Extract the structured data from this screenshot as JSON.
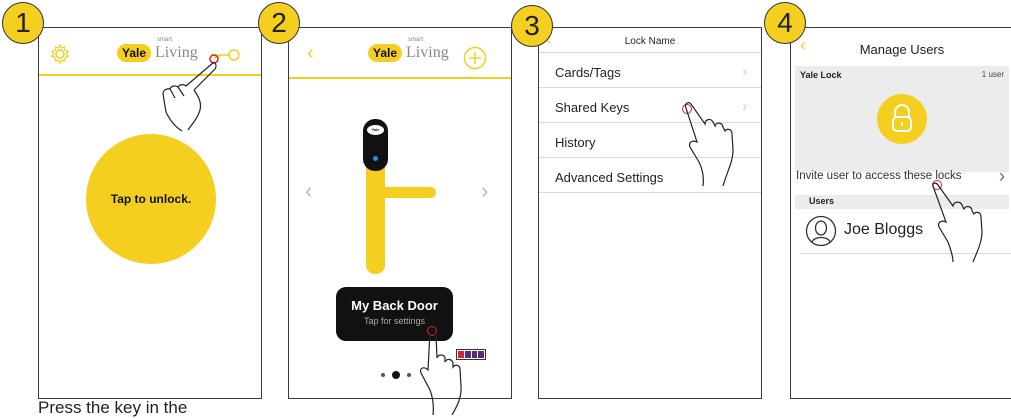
{
  "steps": [
    "1",
    "2",
    "3",
    "4"
  ],
  "panel1": {
    "logo_brand": "Yale",
    "logo_smart": "smart",
    "logo_product": "Living",
    "unlock_button": "Tap to unlock."
  },
  "panel2": {
    "logo_brand": "Yale",
    "logo_smart": "smart",
    "logo_product": "Living",
    "lock_badge": "Yale",
    "door_name": "My Back Door",
    "door_sub": "Tap for settings"
  },
  "panel3": {
    "title": "Lock Name",
    "items": [
      "Cards/Tags",
      "Shared Keys",
      "History",
      "Advanced Settings"
    ]
  },
  "panel4": {
    "title": "Manage Users",
    "lock_name": "Yale Lock",
    "user_count": "1 user",
    "invite_text": "Invite user to access these locks",
    "users_header": "Users",
    "user_name": "Joe Bloggs"
  },
  "caption": "Press the key in the",
  "colors": {
    "accent": "#f5cf1f",
    "tap_marker": "#d9242b",
    "badge_bg": "#111111"
  }
}
